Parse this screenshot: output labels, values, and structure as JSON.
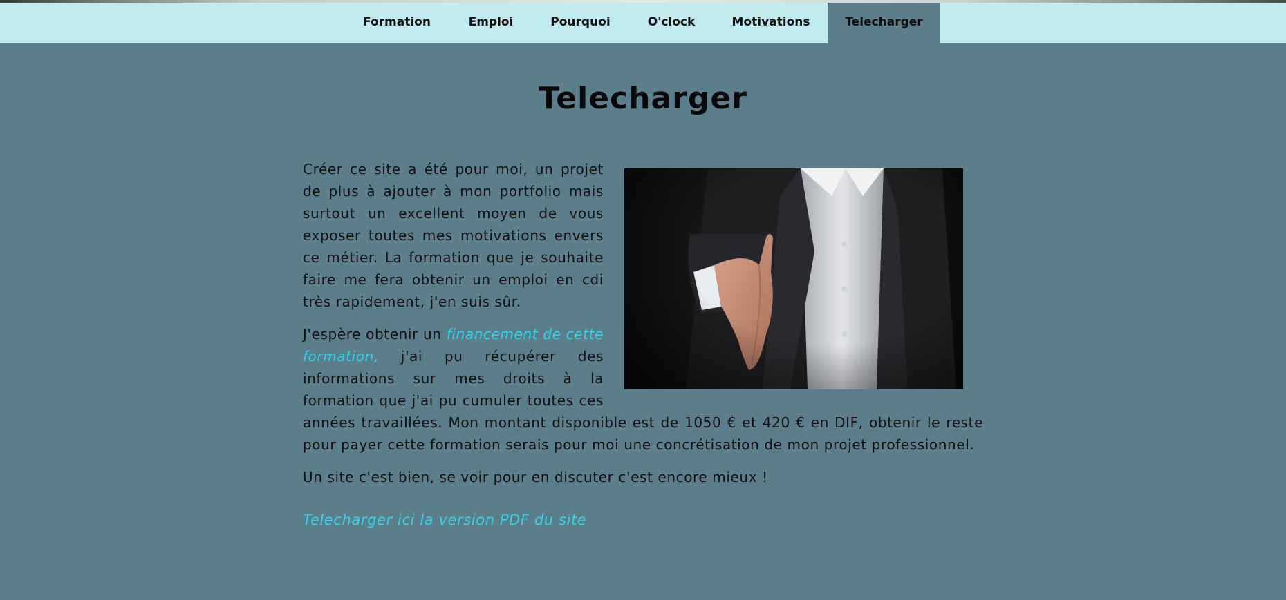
{
  "nav": {
    "items": [
      {
        "label": "Formation"
      },
      {
        "label": "Emploi"
      },
      {
        "label": "Pourquoi"
      },
      {
        "label": "O'clock"
      },
      {
        "label": "Motivations"
      },
      {
        "label": "Telecharger"
      }
    ],
    "active": "Telecharger"
  },
  "page": {
    "title": "Telecharger",
    "paragraph1": "Créer ce site a été pour moi, un projet de plus à ajouter à mon portfolio mais surtout un excellent moyen de vous exposer toutes mes motivations envers ce métier. La formation que je souhaite faire me fera obtenir un emploi en cdi très rapidement, j'en suis sûr.",
    "paragraph2_before": "J'espère obtenir un ",
    "paragraph2_link": "financement de cette formation,",
    "paragraph2_after": " j'ai pu récupérer des informations sur mes droits à la formation que j'ai pu cumuler toutes ces années travaillées. Mon montant disponible est de 1050 € et 420 € en DIF, obtenir le reste pour payer cette formation serais pour moi une concrétisation de mon projet professionnel.",
    "paragraph3": "Un site c'est bien, se voir pour en discuter c'est encore mieux !",
    "pdf_link": "Telecharger ici la version PDF du site"
  },
  "colors": {
    "background": "#5c7e8a",
    "navbar": "#c2ebee",
    "link": "#2fd3ea"
  }
}
